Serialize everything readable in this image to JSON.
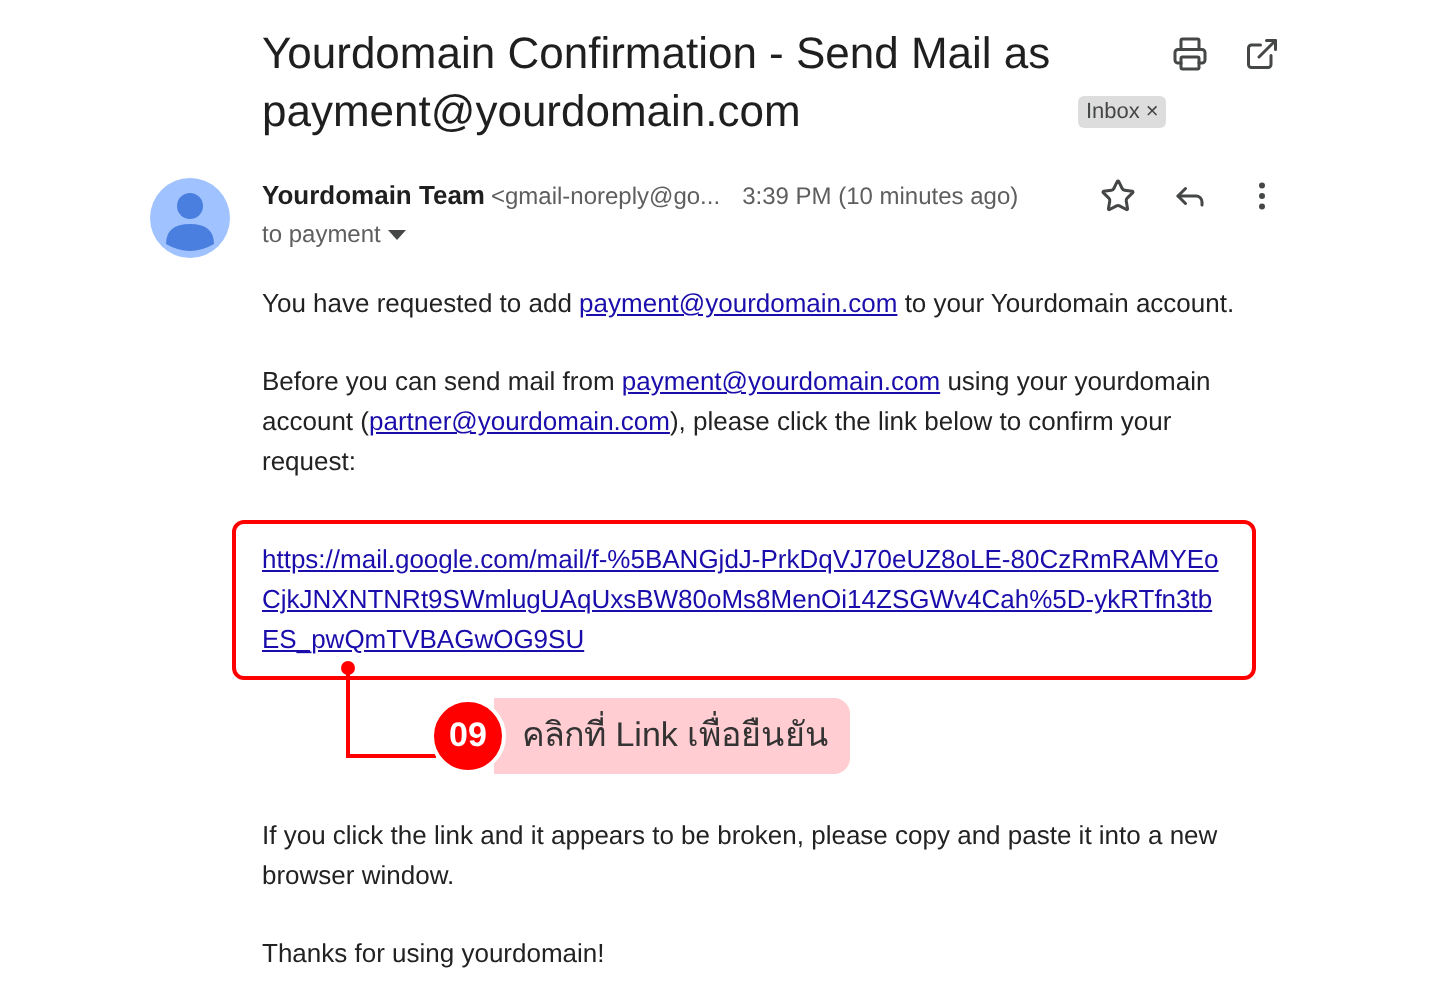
{
  "subject": "Yourdomain Confirmation - Send Mail as payment@yourdomain.com",
  "label": {
    "text": "Inbox",
    "remove": "×"
  },
  "sender": {
    "name": "Yourdomain Team",
    "address": "<gmail-noreply@go...",
    "time": "3:39 PM (10 minutes ago)",
    "recipient": "to payment"
  },
  "body": [
    {
      "kind": "paragraph",
      "parts": [
        {
          "text": "You have requested to add "
        },
        {
          "link": "payment@yourdomain.com"
        },
        {
          "text": " to your Yourdomain account."
        }
      ]
    },
    {
      "kind": "paragraph",
      "parts": [
        {
          "text": "Before you can send mail from "
        },
        {
          "link": "payment@yourdomain.com"
        },
        {
          "text": " using your yourdomain account ("
        },
        {
          "link": "partner@yourdomain.com"
        },
        {
          "text": "), please click the link below to confirm your request:"
        }
      ]
    },
    {
      "kind": "url",
      "link": "https://mail.google.com/mail/f-%5BANGjdJ-PrkDqVJ70eUZ8oLE-80CzRmRAMYEoCjkJNXNTNRt9SWmlugUAqUxsBW80oMs8MenOi14ZSGWv4Cah%5D-ykRTfn3tbES_pwQmTVBAGwOG9SU"
    },
    {
      "kind": "paragraph",
      "parts": [
        {
          "text": "If you click the link and it appears to be broken, please copy and paste it into a new browser window."
        }
      ]
    },
    {
      "kind": "paragraph",
      "parts": [
        {
          "text": "Thanks for using yourdomain!"
        }
      ]
    }
  ],
  "annotation": {
    "number": "09",
    "text": "คลิกที่ Link เพื่อยืนยัน"
  }
}
